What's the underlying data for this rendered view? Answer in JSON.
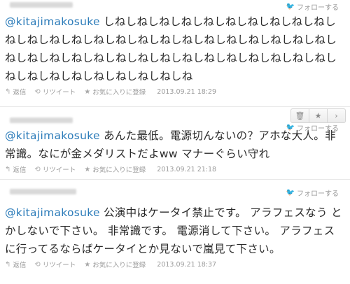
{
  "common": {
    "follow_label": "フォローする",
    "reply_label": "返信",
    "retweet_label": "リツイート",
    "favorite_label": "お気に入りに登録"
  },
  "tweets": [
    {
      "mention": "@kitajimakosuke",
      "text": " しねしねしねしねしねしねしねしねしねしねしねしねしねしねしねしねしねしねしねしねしねしねしねしねしねしねしねしねしねしねしねしねしねしねしねしねしねしねしねしねしねしねしねしねしねしねしねしねしね",
      "date": "2013.09.21 18:29"
    },
    {
      "mention": "@kitajimakosuke",
      "text": " あんた最低。電源切んないの？アホな大人。非常識。なにが金メダリストだよww マナーぐらい守れ",
      "date": "2013.09.21 21:18"
    },
    {
      "mention": "@kitajimakosuke",
      "text": " 公演中はケータイ禁止です。 アラフェスなう とかしないで下さい。 非常識です。 電源消して下さい。 アラフェスに行ってるならばケータイとか見ないで嵐見て下さい。",
      "date": "2013.09.21 18:37"
    }
  ],
  "icons": {
    "bird": "twitter-bird-icon",
    "reply": "reply-icon",
    "retweet": "retweet-icon",
    "favorite": "star-icon",
    "delete": "trash-icon",
    "more": "chevron-right-icon"
  }
}
